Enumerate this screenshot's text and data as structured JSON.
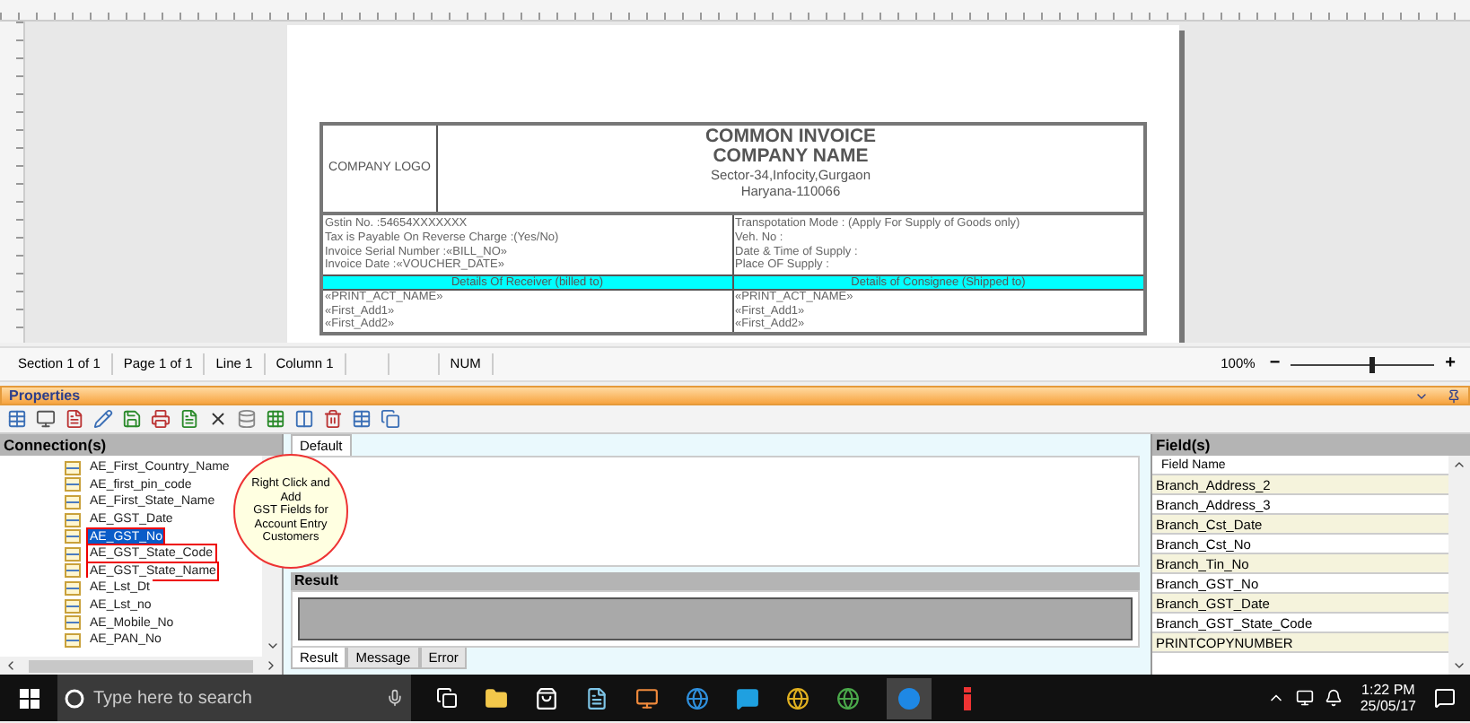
{
  "invoice": {
    "logo": "COMPANY LOGO",
    "title": "COMMON INVOICE",
    "company": "COMPANY NAME",
    "address": [
      "Sector-34,Infocity,Gurgaon",
      "Haryana-110066"
    ],
    "left_details": [
      "Gstin No. :54654XXXXXXX",
      "Tax is Payable On Reverse Charge :(Yes/No)",
      "Invoice Serial Number :«BILL_NO»",
      "Invoice Date :«VOUCHER_DATE»"
    ],
    "right_details": [
      "Transpotation Mode : (Apply For Supply of Goods only)",
      "Veh. No :",
      "Date & Time of Supply :",
      "Place OF Supply :"
    ],
    "receiver_header": "Details Of Receiver (billed to)",
    "consignee_header": "Details of Consignee (Shipped to)",
    "receiver_lines": [
      "«PRINT_ACT_NAME»",
      "«First_Add1»",
      "«First_Add2»"
    ],
    "consignee_lines": [
      "«PRINT_ACT_NAME»",
      "«First_Add1»",
      "«First_Add2»"
    ]
  },
  "status_bar": {
    "cells": [
      "Section 1 of 1",
      "Page 1 of 1",
      "Line 1",
      "Column 1",
      "NUM"
    ],
    "zoom": "100%",
    "minus": "−",
    "plus": "+",
    "level": 0.56
  },
  "properties": {
    "title": "Properties"
  },
  "connections": {
    "title": "Connection(s)",
    "items": [
      {
        "label": "AE_First_Country_Name",
        "selected": false,
        "marked": false
      },
      {
        "label": "AE_first_pin_code",
        "selected": false,
        "marked": false
      },
      {
        "label": "AE_First_State_Name",
        "selected": false,
        "marked": false
      },
      {
        "label": "AE_GST_Date",
        "selected": false,
        "marked": false
      },
      {
        "label": "AE_GST_No",
        "selected": true,
        "marked": true
      },
      {
        "label": "AE_GST_State_Code",
        "selected": false,
        "marked": true
      },
      {
        "label": "AE_GST_State_Name",
        "selected": false,
        "marked": true
      },
      {
        "label": "AE_Lst_Dt",
        "selected": false,
        "marked": false
      },
      {
        "label": "AE_Lst_no",
        "selected": false,
        "marked": false
      },
      {
        "label": "AE_Mobile_No",
        "selected": false,
        "marked": false
      },
      {
        "label": "AE_PAN_No",
        "selected": false,
        "marked": false
      }
    ],
    "callout": [
      "Right Click and",
      "Add",
      "GST Fields for",
      "Account Entry",
      "Customers"
    ]
  },
  "editor": {
    "tabs": [
      {
        "label": "Default",
        "selected": true
      }
    ]
  },
  "result": {
    "title": "Result",
    "tabs": [
      {
        "label": "Result",
        "selected": true
      },
      {
        "label": "Message",
        "selected": false
      },
      {
        "label": "Error",
        "selected": false
      }
    ]
  },
  "fields": {
    "title": "Field(s)",
    "column": "Field Name",
    "rows": [
      "Branch_Address_2",
      "Branch_Address_3",
      "Branch_Cst_Date",
      "Branch_Cst_No",
      "Branch_Tin_No",
      "Branch_GST_No",
      "Branch_GST_Date",
      "Branch_GST_State_Code",
      "PRINTCOPYNUMBER"
    ]
  },
  "taskbar": {
    "search_placeholder": "Type here to search",
    "time": "1:22 PM",
    "date": "25/05/17"
  }
}
